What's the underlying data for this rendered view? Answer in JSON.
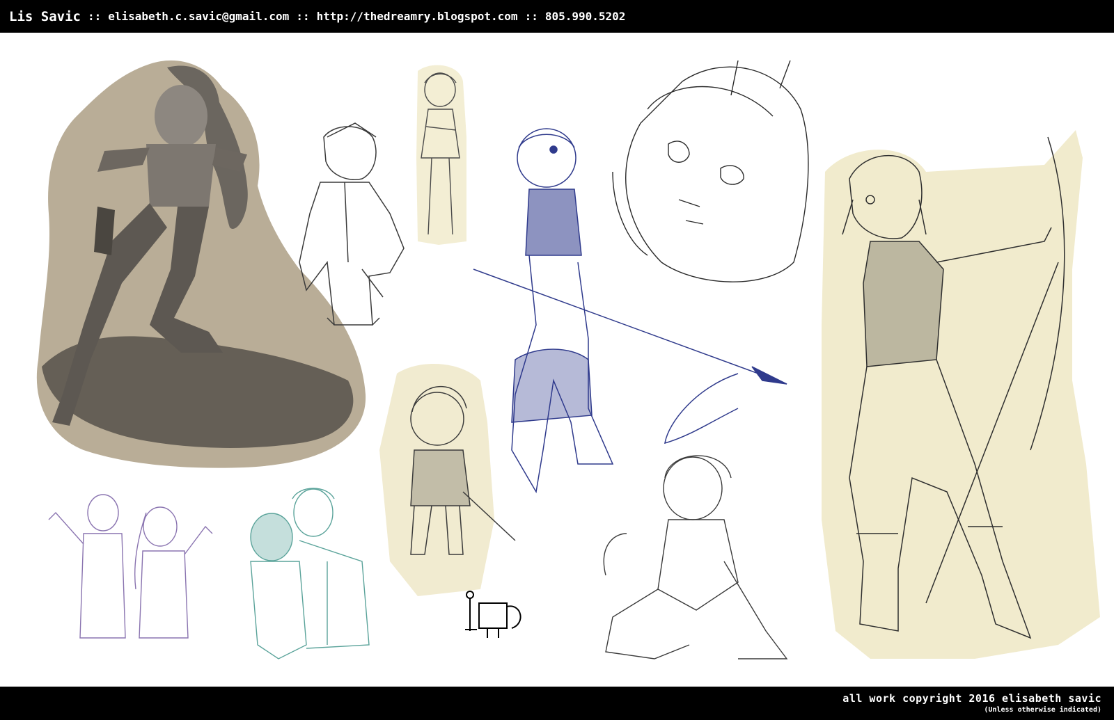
{
  "header": {
    "name": "Lis Savic",
    "separator": "::",
    "email": "elisabeth.c.savic@gmail.com",
    "website": "http://thedreamry.blogspot.com",
    "phone": "805.990.5202"
  },
  "footer": {
    "copyright": "all work copyright 2016 elisabeth savic",
    "note": "(Unless otherwise indicated)"
  },
  "colors": {
    "bar": "#000000",
    "kraft_paper": "#b8ab95",
    "yellow_paper": "#f3edd3",
    "blue_ink": "#2f3a8c",
    "purple_ink": "#8a74b0",
    "teal_ink": "#5aa39a",
    "pencil": "#3a3a3a"
  }
}
